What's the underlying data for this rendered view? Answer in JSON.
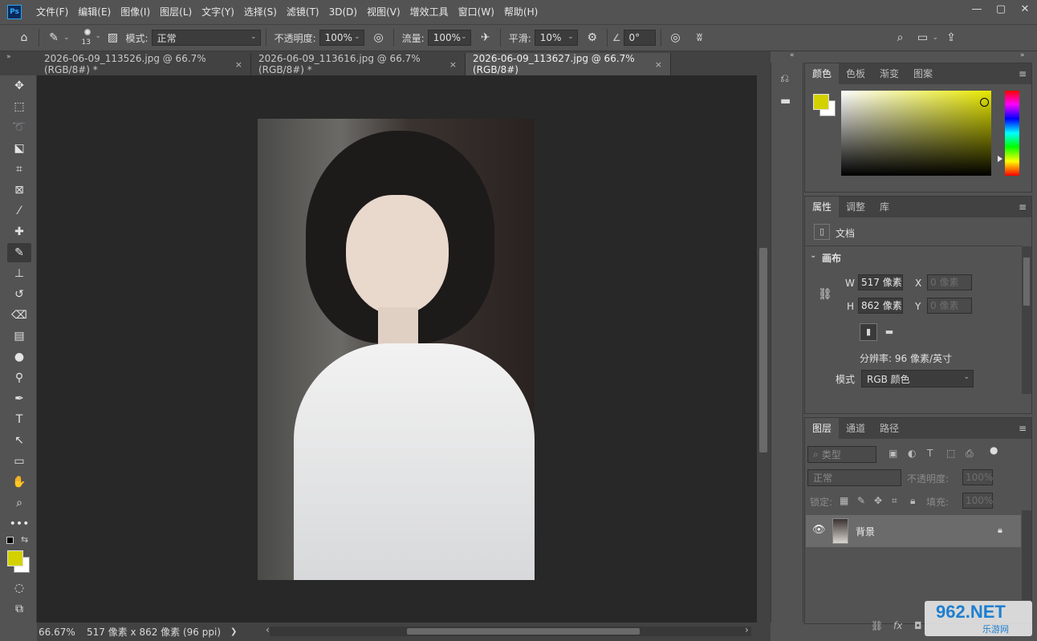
{
  "app": {
    "logo": "Ps"
  },
  "menu": [
    "文件(F)",
    "编辑(E)",
    "图像(I)",
    "图层(L)",
    "文字(Y)",
    "选择(S)",
    "滤镜(T)",
    "3D(D)",
    "视图(V)",
    "增效工具",
    "窗口(W)",
    "帮助(H)"
  ],
  "window_controls": {
    "minimize": "—",
    "maximize": "▢",
    "close": "✕"
  },
  "options": {
    "brush_size": "13",
    "mode_label": "模式:",
    "mode_value": "正常",
    "opacity_label": "不透明度:",
    "opacity_value": "100%",
    "flow_label": "流量:",
    "flow_value": "100%",
    "smoothing_label": "平滑:",
    "smoothing_value": "10%",
    "angle_value": "0°"
  },
  "tabs": [
    {
      "label": "2026-06-09_113526.jpg @ 66.7%(RGB/8#) *",
      "close": "×"
    },
    {
      "label": "2026-06-09_113616.jpg @ 66.7%(RGB/8#) *",
      "close": "×"
    },
    {
      "label": "2026-06-09_113627.jpg @ 66.7%(RGB/8#)",
      "close": "×"
    }
  ],
  "collapse_icon": "»",
  "expand_icon": "«",
  "status": {
    "zoom": "66.67%",
    "doc_info": "517 像素 x 862 像素 (96 ppi)",
    "arrow": "❯",
    "left_arrow": "‹",
    "right_arrow": "›"
  },
  "color_panel": {
    "tabs": [
      "颜色",
      "色板",
      "渐变",
      "图案"
    ],
    "fg_color": "#d3d100",
    "bg_color": "#ffffff"
  },
  "properties_panel": {
    "tabs": [
      "属性",
      "调整",
      "库"
    ],
    "doc_label": "文档",
    "section": "画布",
    "w_label": "W",
    "w_value": "517 像素",
    "h_label": "H",
    "h_value": "862 像素",
    "x_label": "X",
    "x_value": "0 像素",
    "y_label": "Y",
    "y_value": "0 像素",
    "resolution": "分辨率: 96 像素/英寸",
    "mode_label": "模式",
    "mode_value": "RGB 颜色"
  },
  "layers_panel": {
    "tabs": [
      "图层",
      "通道",
      "路径"
    ],
    "filter_placeholder": "类型",
    "blend_value": "正常",
    "opacity_label": "不透明度:",
    "opacity_value": "100%",
    "lock_label": "锁定:",
    "fill_label": "填充:",
    "fill_value": "100%",
    "layer_name": "背景",
    "footer_fx": "fx"
  },
  "watermark": {
    "brand": "962.NET",
    "sub": "乐游网"
  }
}
